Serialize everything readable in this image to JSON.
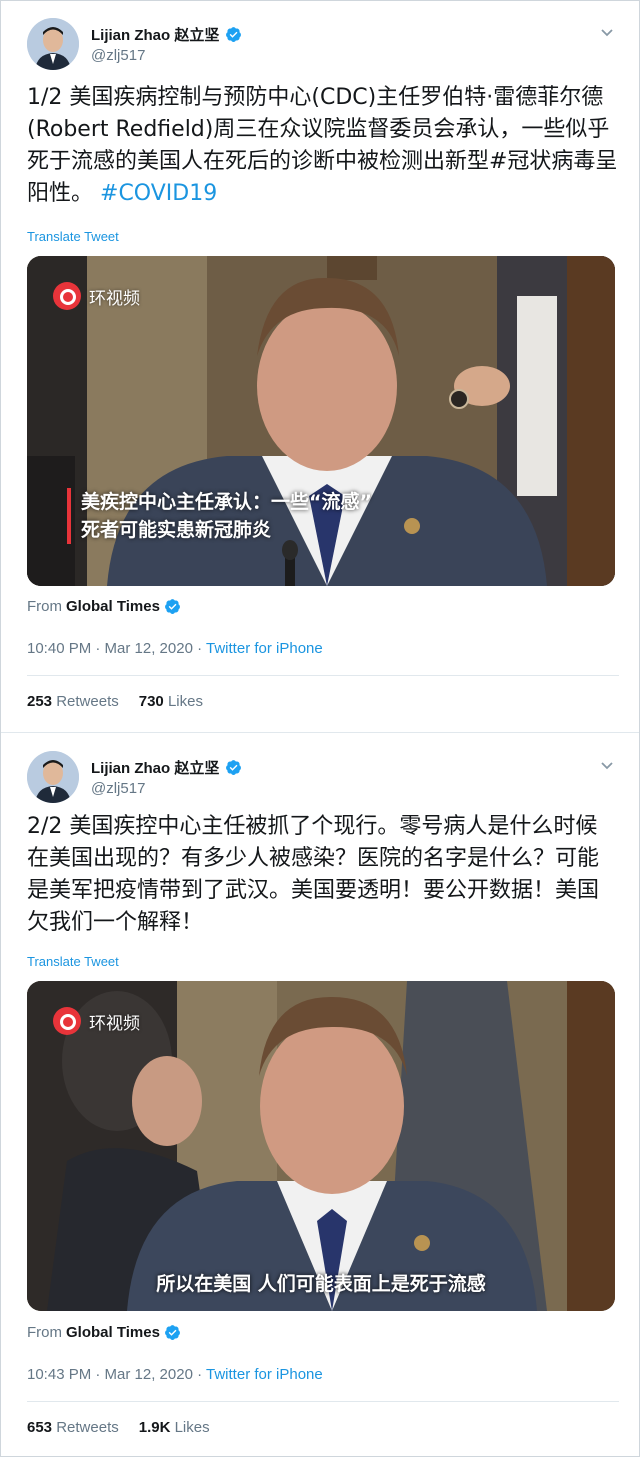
{
  "colors": {
    "link": "#1b95e0",
    "muted": "#657786",
    "text": "#14171a",
    "subtitle_bar": "#e8343a"
  },
  "tweets": [
    {
      "author": {
        "name": "Lijian Zhao 赵立坚",
        "handle": "@zlj517",
        "verified": true,
        "avatar_icon": "avatar-portrait"
      },
      "text": "1/2 美国疾病控制与预防中心(CDC)主任罗伯特·雷德菲尔德(Robert Redfield)周三在众议院监督委员会承认，一些似乎死于流感的美国人在死后的诊断中被检测出新型#冠状病毒呈阳性。",
      "hashtag": "#COVID19",
      "translate_label": "Translate Tweet",
      "video": {
        "channel_logo": "环视频",
        "subtitle_lines": [
          "美疾控中心主任承认：一些“流感”",
          "死者可能实患新冠肺炎"
        ]
      },
      "from_label": "From",
      "source": "Global Times",
      "time": "10:40 PM · Mar 12, 2020",
      "client": "Twitter for iPhone",
      "retweets": "253",
      "retweets_label": "Retweets",
      "likes": "730",
      "likes_label": "Likes"
    },
    {
      "author": {
        "name": "Lijian Zhao 赵立坚",
        "handle": "@zlj517",
        "verified": true,
        "avatar_icon": "avatar-portrait"
      },
      "text": "2/2 美国疾控中心主任被抓了个现行。零号病人是什么时候在美国出现的？有多少人被感染？医院的名字是什么？可能是美军把疫情带到了武汉。美国要透明！要公开数据！美国欠我们一个解释！",
      "translate_label": "Translate Tweet",
      "video": {
        "channel_logo": "环视频",
        "subtitle": "所以在美国 人们可能表面上是死于流感"
      },
      "from_label": "From",
      "source": "Global Times",
      "time": "10:43 PM · Mar 12, 2020",
      "client": "Twitter for iPhone",
      "retweets": "653",
      "retweets_label": "Retweets",
      "likes": "1.9K",
      "likes_label": "Likes"
    }
  ]
}
